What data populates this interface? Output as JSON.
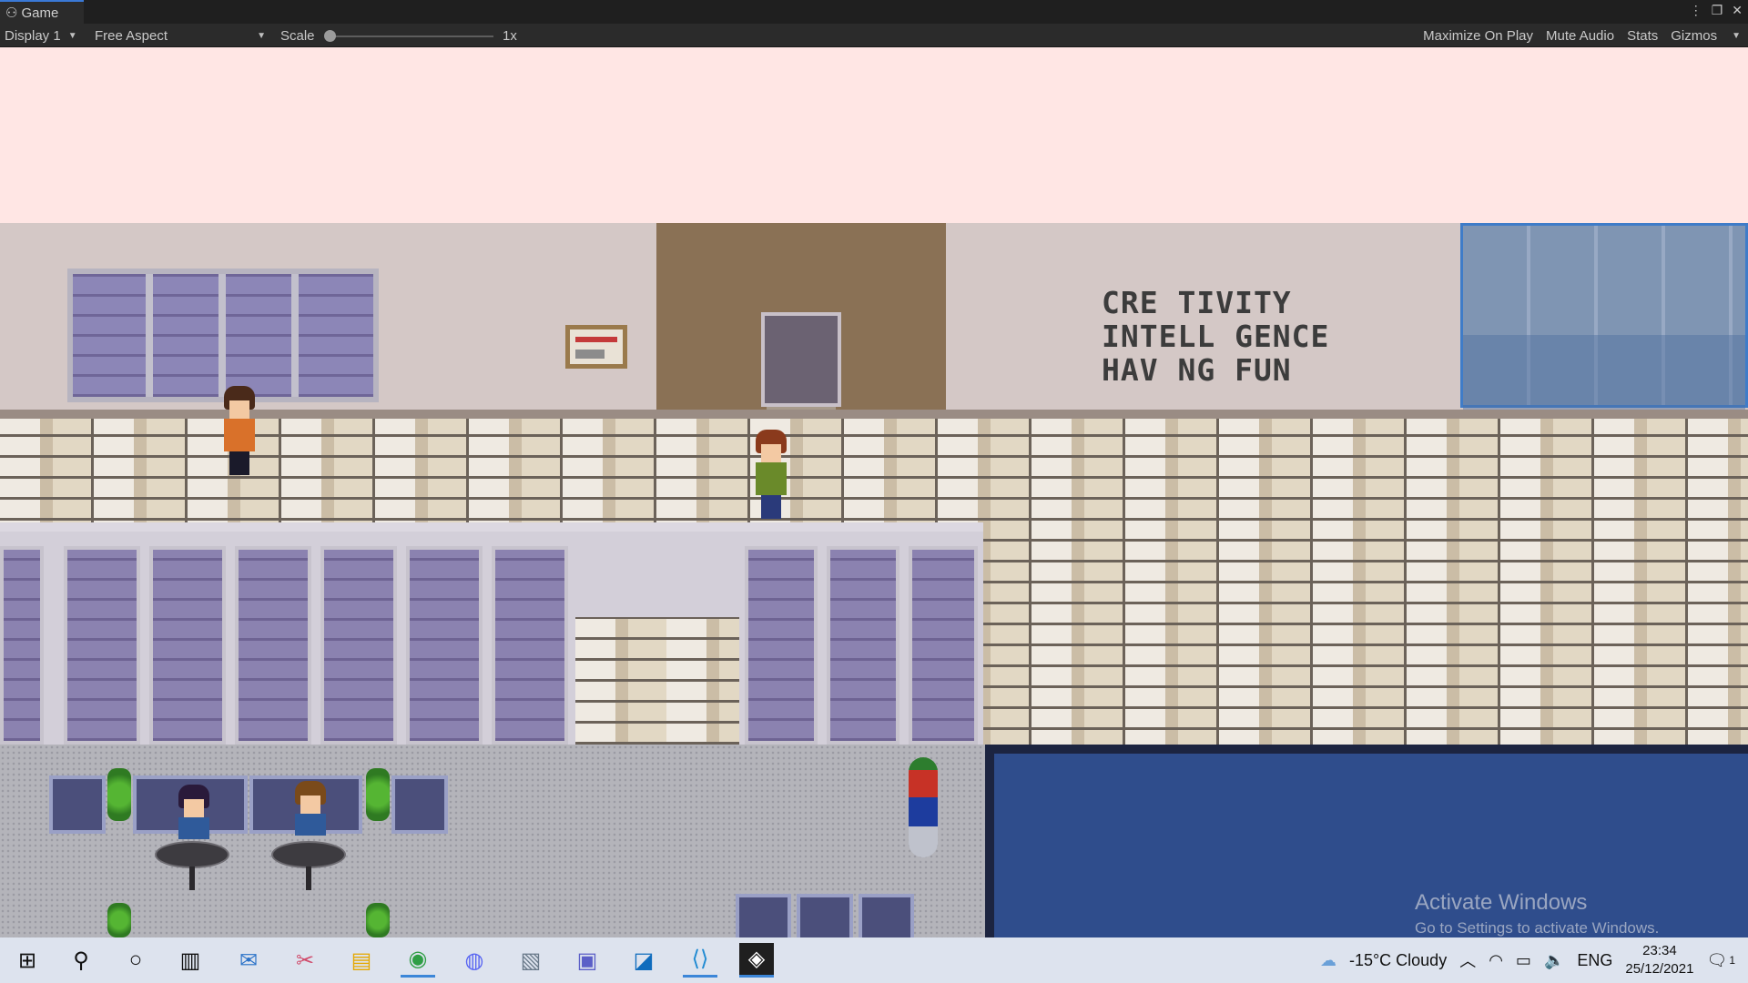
{
  "window": {
    "tab_label": "Game",
    "controls": [
      "⋮",
      "❐",
      "✕"
    ]
  },
  "toolbar": {
    "display": "Display 1",
    "aspect": "Free Aspect",
    "scale_label": "Scale",
    "scale_value": "1x",
    "maximize": "Maximize On Play",
    "mute": "Mute Audio",
    "stats": "Stats",
    "gizmos": "Gizmos"
  },
  "game": {
    "wall_text": [
      "CRE TIVITY",
      "INTELL GENCE",
      "HAV NG FUN"
    ],
    "watermark": {
      "title": "Activate Windows",
      "subtitle": "Go to Settings to activate Windows."
    }
  },
  "taskbar": {
    "apps": [
      "start-icon",
      "search-icon",
      "cortana-icon",
      "task-view-icon",
      "mail-icon",
      "snip-icon",
      "explorer-icon",
      "chrome-icon",
      "discord-icon",
      "photos-icon",
      "teams-icon",
      "outlook-icon",
      "vscode-icon",
      "unity-icon"
    ],
    "weather": "-15°C  Cloudy",
    "language": "ENG",
    "time": "23:34",
    "date": "25/12/2021",
    "notifications": "1"
  }
}
